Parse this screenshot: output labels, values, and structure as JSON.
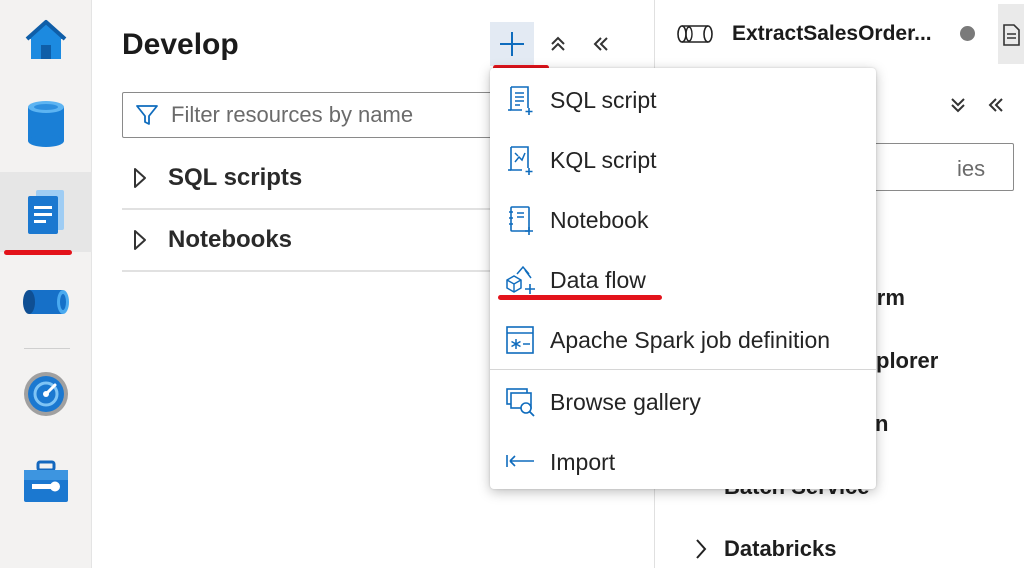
{
  "activity_bar": {
    "items": [
      {
        "name": "home",
        "icon": "home-icon"
      },
      {
        "name": "data",
        "icon": "database-icon"
      },
      {
        "name": "develop",
        "icon": "document-icon",
        "active": true
      },
      {
        "name": "integrate",
        "icon": "pipeline-icon"
      },
      {
        "name": "monitor",
        "icon": "gauge-icon"
      },
      {
        "name": "manage",
        "icon": "toolbox-icon"
      }
    ]
  },
  "develop": {
    "title": "Develop",
    "filter_placeholder": "Filter resources by name",
    "tree": [
      {
        "label": "SQL scripts"
      },
      {
        "label": "Notebooks"
      }
    ]
  },
  "right_panel": {
    "tab_title": "ExtractSalesOrder...",
    "search_partial": "ies",
    "items": [
      {
        "label": "form"
      },
      {
        "label": "plorer"
      },
      {
        "label": "n"
      },
      {
        "label": "Batch Service"
      },
      {
        "label": "Databricks"
      }
    ]
  },
  "add_menu": {
    "items": [
      {
        "label": "SQL script",
        "icon": "sql-script-icon"
      },
      {
        "label": "KQL script",
        "icon": "kql-script-icon"
      },
      {
        "label": "Notebook",
        "icon": "notebook-icon"
      },
      {
        "label": "Data flow",
        "icon": "data-flow-icon"
      },
      {
        "label": "Apache Spark job definition",
        "icon": "spark-job-icon"
      },
      {
        "label": "Browse gallery",
        "icon": "gallery-icon"
      },
      {
        "label": "Import",
        "icon": "import-icon"
      }
    ]
  },
  "colors": {
    "accent": "#0f6cbd",
    "highlight_red": "#e3131b",
    "plus_button_bg": "#e3eaf3"
  }
}
